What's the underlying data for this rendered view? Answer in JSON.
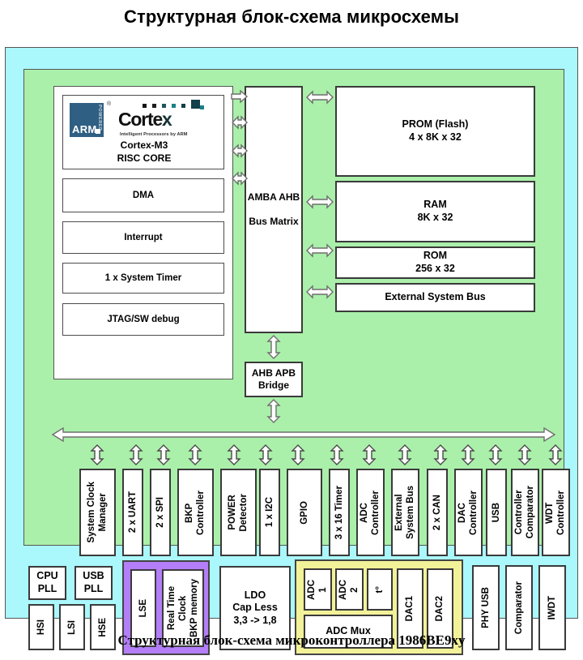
{
  "title": "Структурная блок-схема микросхемы",
  "caption": "Структурная блок-схема микроконтроллера 1986ВЕ9xy",
  "colors": {
    "chip_background": "#aaf7fc",
    "digital_background": "#aaf0aa",
    "cpu_container": "#ffffff",
    "rtc_group": "#b37ef7",
    "analog_group": "#f2f299",
    "arm_logo": "#2f5f82",
    "block_fill": "#ffffff",
    "block_border": "#4c4c4c"
  },
  "core": {
    "arm_logo_text": "ARM",
    "arm_powered": "POWERED",
    "registered_mark": "®",
    "cortex_wordmark": "Cortex",
    "cortex_tagline": "Intelligent Processors by ARM",
    "trademark": "™",
    "label": "Cortex-M3\nRISC CORE"
  },
  "cpu_blocks": [
    {
      "label": "DMA"
    },
    {
      "label": "Interrupt"
    },
    {
      "label": "1 x System Timer"
    },
    {
      "label": "JTAG/SW debug"
    }
  ],
  "bus_matrix": {
    "label": "AMBA AHB\n\nBus Matrix"
  },
  "memory_blocks": [
    {
      "label": "PROM (Flash)\n4 x 8K x 32"
    },
    {
      "label": "RAM\n8K x 32"
    },
    {
      "label": "ROM\n256 x 32"
    },
    {
      "label": "External System Bus"
    }
  ],
  "bridge": {
    "label": "AHB APB\nBridge"
  },
  "apb_bus": {
    "name": "APB peripheral bus"
  },
  "peripherals": [
    {
      "label": "System Clock\nManager"
    },
    {
      "label": "2 x UART"
    },
    {
      "label": "2 x SPI"
    },
    {
      "label": "BKP\nController"
    },
    {
      "label": "POWER\nDetector"
    },
    {
      "label": "1 x I2C"
    },
    {
      "label": "GPIO"
    },
    {
      "label": "3 x 16 Timer"
    },
    {
      "label": "ADC\nController"
    },
    {
      "label": "External\nSystem Bus"
    },
    {
      "label": "2 x CAN"
    },
    {
      "label": "DAC\nController"
    },
    {
      "label": "USB"
    },
    {
      "label": "Controller\nComparator"
    },
    {
      "label": "WDT\nController"
    }
  ],
  "clock_blocks": [
    {
      "label": "CPU\nPLL"
    },
    {
      "label": "USB\nPLL"
    },
    {
      "label": "HSI"
    },
    {
      "label": "LSI"
    },
    {
      "label": "HSE"
    }
  ],
  "rtc_group": {
    "blocks": [
      {
        "label": "LSE"
      },
      {
        "label": "Real Time\nClock\nBKP memory"
      }
    ]
  },
  "ldo": {
    "label": "LDO\nCap Less\n3,3 -> 1,8"
  },
  "analog_group": {
    "blocks": [
      {
        "label": "ADC\n1"
      },
      {
        "label": "ADC\n2"
      },
      {
        "label": "t°"
      },
      {
        "label": "ADC Mux"
      },
      {
        "label": "DAC1"
      },
      {
        "label": "DAC2"
      }
    ]
  },
  "analog_outer": [
    {
      "label": "PHY USB"
    },
    {
      "label": "Comparator"
    },
    {
      "label": "IWDT"
    }
  ]
}
